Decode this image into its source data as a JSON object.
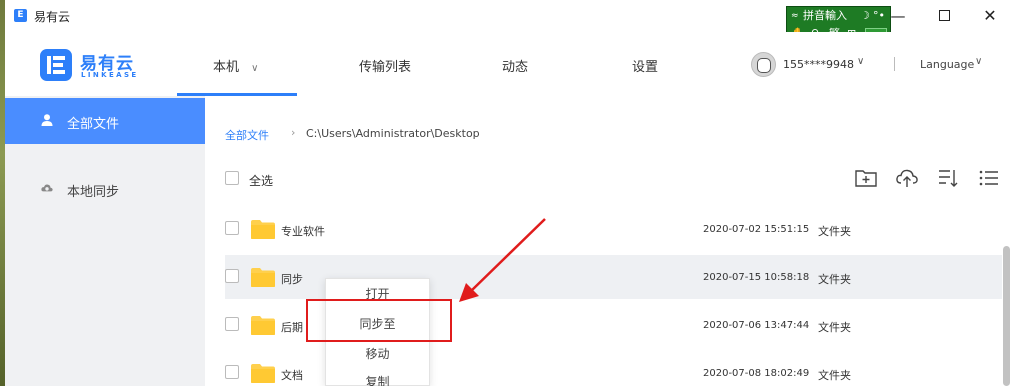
{
  "titlebar": {
    "app_icon": "E",
    "title": "易有云",
    "min": "—",
    "close": "✕"
  },
  "ime": {
    "mode": "拼音輸入",
    "moon": "☽",
    "dots": "°•",
    "hand": "✋",
    "search": "⚲",
    "trad": "繁",
    "grid": "⊞",
    "arrows": "≈"
  },
  "header": {
    "logo_name": "易有云",
    "logo_sub": "LINKEASE",
    "nav_local": "本机",
    "nav_local_chev": "∨",
    "nav_transfer": "传输列表",
    "nav_activity": "动态",
    "nav_settings": "设置",
    "user": "155****9948",
    "user_chev": "∨",
    "language": "Language",
    "lang_chev": "∨"
  },
  "sidebar": {
    "items": [
      {
        "label": "全部文件",
        "icon": "user-icon",
        "active": true
      },
      {
        "label": "本地同步",
        "icon": "cloud-sync-icon",
        "active": false
      }
    ]
  },
  "breadcrumb": {
    "root": "全部文件",
    "sep": "›",
    "path": "C:\\Users\\Administrator\\Desktop"
  },
  "select_all": "全选",
  "toolbar_icons": [
    "new-folder-icon",
    "upload-icon",
    "sort-icon",
    "list-view-icon"
  ],
  "files": [
    {
      "name": "专业软件",
      "date": "2020-07-02 15:51:15",
      "type": "文件夹"
    },
    {
      "name": "同步",
      "date": "2020-07-15 10:58:18",
      "type": "文件夹"
    },
    {
      "name": "后期",
      "date": "2020-07-06 13:47:44",
      "type": "文件夹"
    },
    {
      "name": "文档",
      "date": "2020-07-08 18:02:49",
      "type": "文件夹"
    }
  ],
  "context_menu": {
    "open": "打开",
    "sync_to": "同步至",
    "move": "移动",
    "copy": "复制"
  },
  "colors": {
    "accent": "#2d7ff9",
    "sidebar_active": "#4a8dff",
    "highlight": "#e01c1c",
    "folder": "#ffd04d"
  }
}
